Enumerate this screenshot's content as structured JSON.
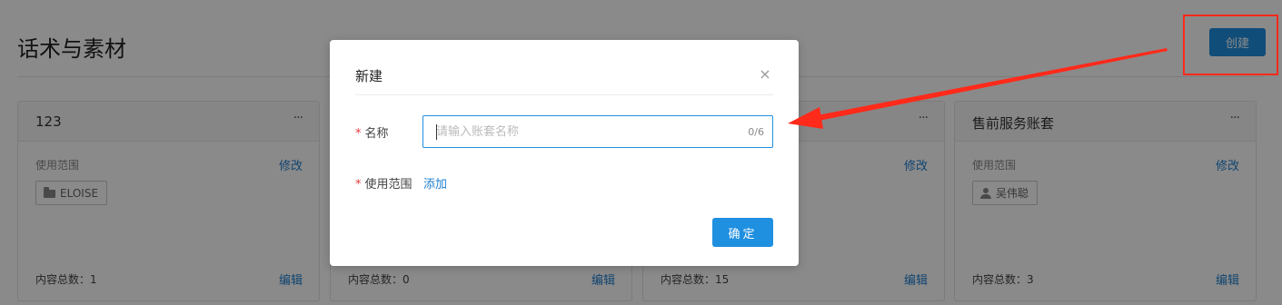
{
  "page": {
    "title": "话术与素材",
    "create_label": "创建"
  },
  "cards": [
    {
      "title": "123",
      "scope_label": "使用范围",
      "edit_scope_label": "修改",
      "tag": {
        "icon": "folder-icon",
        "text": "ELOISE"
      },
      "count_text": "内容总数：1",
      "edit_label": "编辑"
    },
    {
      "title": "",
      "scope_label": "",
      "edit_scope_label": "",
      "count_text": "内容总数：0",
      "edit_label": "编辑"
    },
    {
      "title": "",
      "scope_label": "",
      "edit_scope_label": "修改",
      "count_text": "内容总数：15",
      "edit_label": "编辑"
    },
    {
      "title": "售前服务账套",
      "scope_label": "使用范围",
      "edit_scope_label": "修改",
      "tag": {
        "icon": "user-icon",
        "text": "吴伟聪"
      },
      "count_text": "内容总数：3",
      "edit_label": "编辑"
    }
  ],
  "more_glyph": "···",
  "modal": {
    "title": "新建",
    "close_glyph": "×",
    "name_label": "名称",
    "name_required": "*",
    "name_placeholder": "请输入账套名称",
    "name_value": "",
    "name_counter": "0/6",
    "scope_label": "使用范围",
    "scope_required": "*",
    "scope_add_label": "添加",
    "confirm_label": "确定"
  },
  "colors": {
    "accent": "#1f8fe0",
    "link": "#1f7fd0",
    "required": "#e4393c",
    "annotation": "#ff2a1a"
  }
}
